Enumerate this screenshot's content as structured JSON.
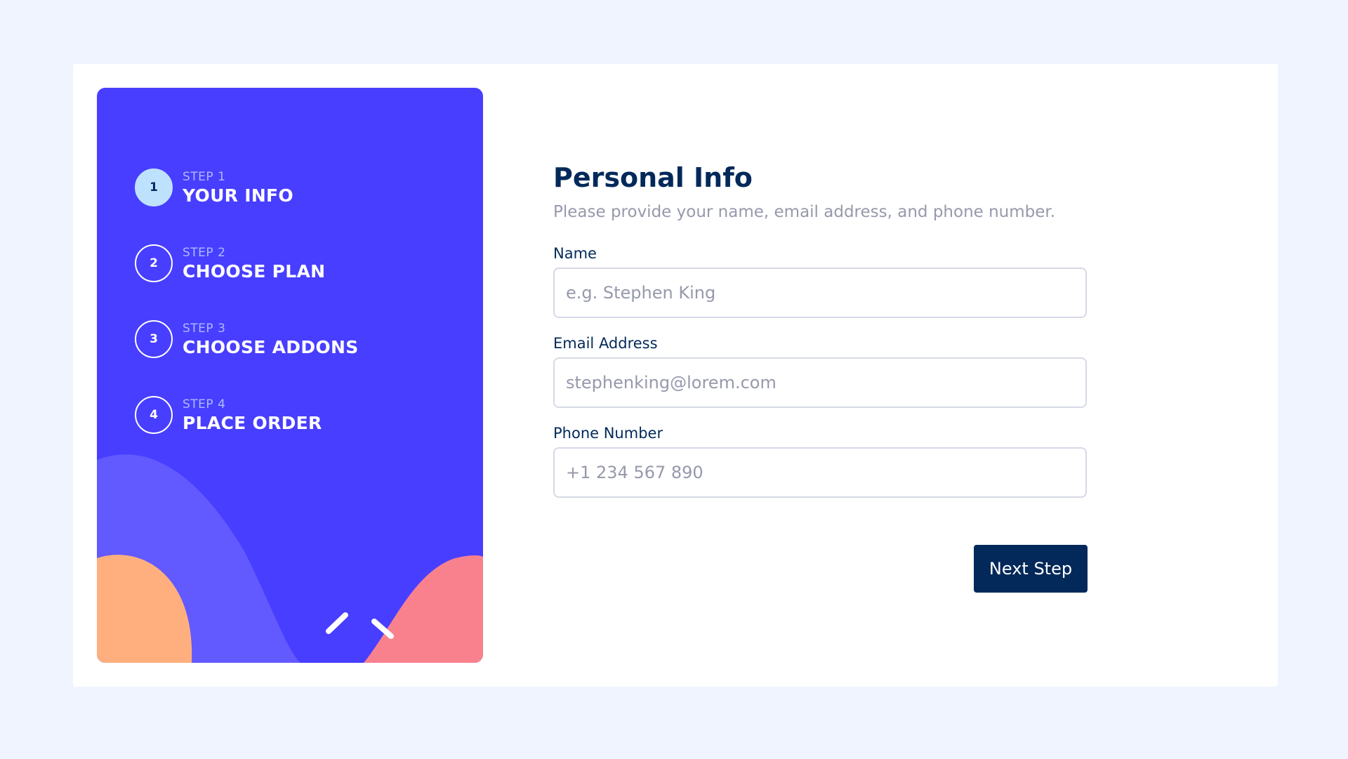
{
  "colors": {
    "page_background": "#eff4ff",
    "sidebar_background": "#483eff",
    "active_step": "#bee2fd",
    "primary_text": "#02295a",
    "muted_text": "#9699ab",
    "button_background": "#02295a"
  },
  "sidebar": {
    "steps": [
      {
        "number": "1",
        "label": "STEP 1",
        "title": "YOUR INFO",
        "active": true
      },
      {
        "number": "2",
        "label": "STEP 2",
        "title": "CHOOSE PLAN",
        "active": false
      },
      {
        "number": "3",
        "label": "STEP 3",
        "title": "CHOOSE ADDONS",
        "active": false
      },
      {
        "number": "4",
        "label": "STEP 4",
        "title": "PLACE ORDER",
        "active": false
      }
    ]
  },
  "form": {
    "title": "Personal Info",
    "subtitle": "Please provide your name, email address, and phone number.",
    "fields": [
      {
        "label": "Name",
        "placeholder": "e.g. Stephen King",
        "value": ""
      },
      {
        "label": "Email Address",
        "placeholder": "stephenking@lorem.com",
        "value": ""
      },
      {
        "label": "Phone Number",
        "placeholder": "+1 234 567 890",
        "value": ""
      }
    ],
    "next_button": "Next Step"
  }
}
